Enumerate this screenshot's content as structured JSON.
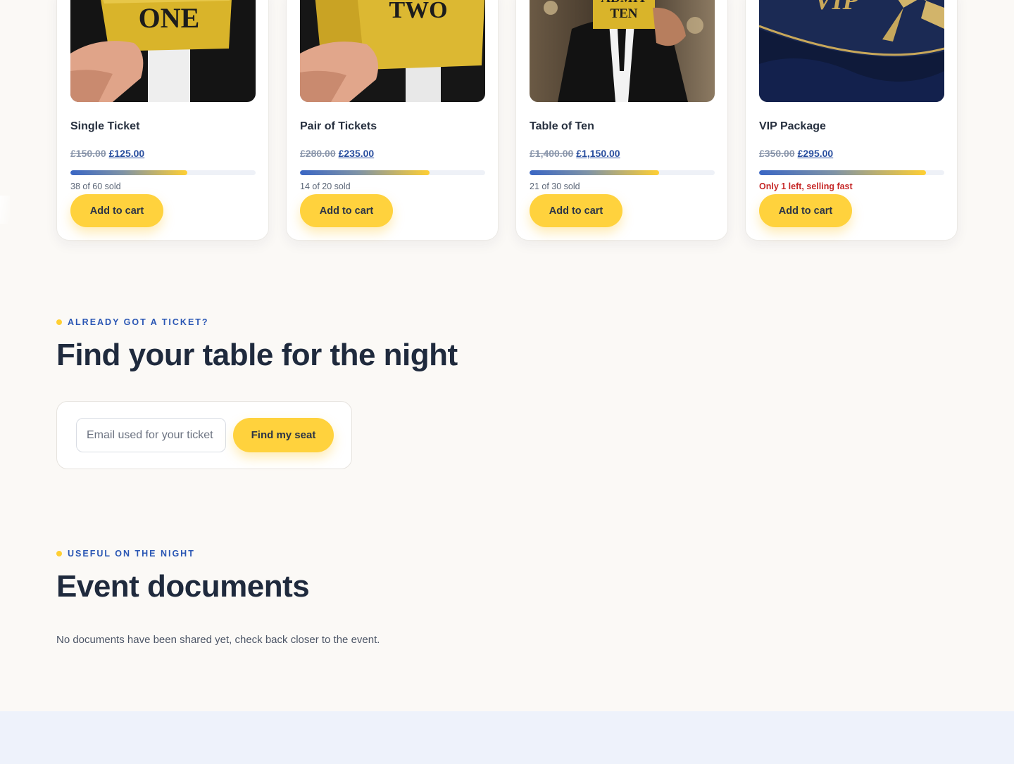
{
  "tickets": [
    {
      "title": "Single Ticket",
      "was_price": "£150.00",
      "price": "£125.00",
      "sold_fraction": 0.633,
      "status": "38 of 60 sold",
      "urgent": false,
      "button": "Add to cart",
      "image_label": "ONE",
      "image_kind": "ticket"
    },
    {
      "title": "Pair of Tickets",
      "was_price": "£280.00",
      "price": "£235.00",
      "sold_fraction": 0.7,
      "status": "14 of 20 sold",
      "urgent": false,
      "button": "Add to cart",
      "image_label": "TWO",
      "image_kind": "ticket"
    },
    {
      "title": "Table of Ten",
      "was_price": "£1,400.00",
      "price": "£1,150.00",
      "sold_fraction": 0.7,
      "status": "21 of 30 sold",
      "urgent": false,
      "button": "Add to cart",
      "image_label": "ADMIT TEN",
      "image_kind": "person"
    },
    {
      "title": "VIP Package",
      "was_price": "£350.00",
      "price": "£295.00",
      "sold_fraction": 0.9,
      "status": "Only 1 left, selling fast",
      "urgent": true,
      "button": "Add to cart",
      "image_label": "VIP",
      "image_kind": "vip"
    }
  ],
  "find_table": {
    "eyebrow": "ALREADY GOT A TICKET?",
    "heading": "Find your table for the night",
    "email_placeholder": "Email used for your ticket",
    "button": "Find my seat"
  },
  "documents": {
    "eyebrow": "USEFUL ON THE NIGHT",
    "heading": "Event documents",
    "empty_text": "No documents have been shared yet, check back closer to the event."
  },
  "colors": {
    "accent_yellow": "#ffd23d",
    "brand_blue": "#2a56b4",
    "urgent_red": "#c62828",
    "page_bg": "#fbf9f6",
    "footer_bg": "#eef2fb"
  }
}
